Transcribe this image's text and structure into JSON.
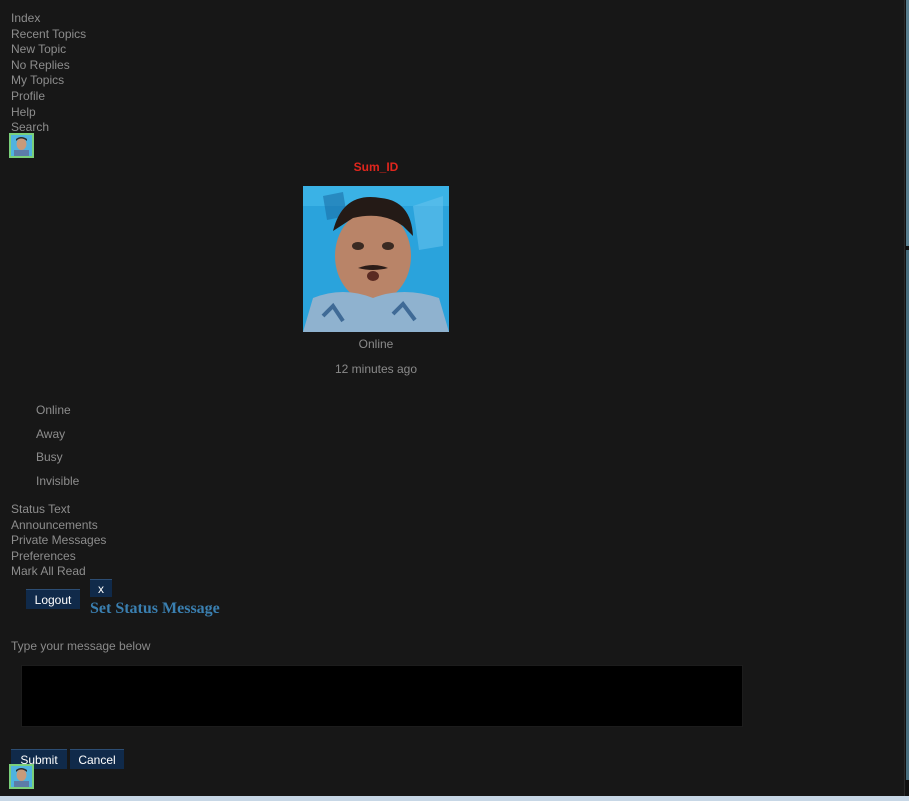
{
  "nav": {
    "items": [
      "Index",
      "Recent Topics",
      "New Topic",
      "No Replies",
      "My Topics",
      "Profile",
      "Help",
      "Search"
    ]
  },
  "user": {
    "name": "Sum_ID",
    "status": "Online",
    "last_seen": "12 minutes ago"
  },
  "status_options": [
    "Online",
    "Away",
    "Busy",
    "Invisible"
  ],
  "nav2": {
    "items": [
      "Status Text",
      "Announcements",
      "Private Messages",
      "Preferences",
      "Mark All Read"
    ]
  },
  "logout_label": "Logout",
  "dialog": {
    "close_label": "x",
    "title": "Set Status Message",
    "prompt": "Type your message below",
    "message_value": "",
    "submit_label": "Submit",
    "cancel_label": "Cancel"
  },
  "colors": {
    "background": "#171717",
    "username": "#e0261d",
    "dialog_title": "#3a7fb0",
    "button_bg": "#102a4a"
  }
}
